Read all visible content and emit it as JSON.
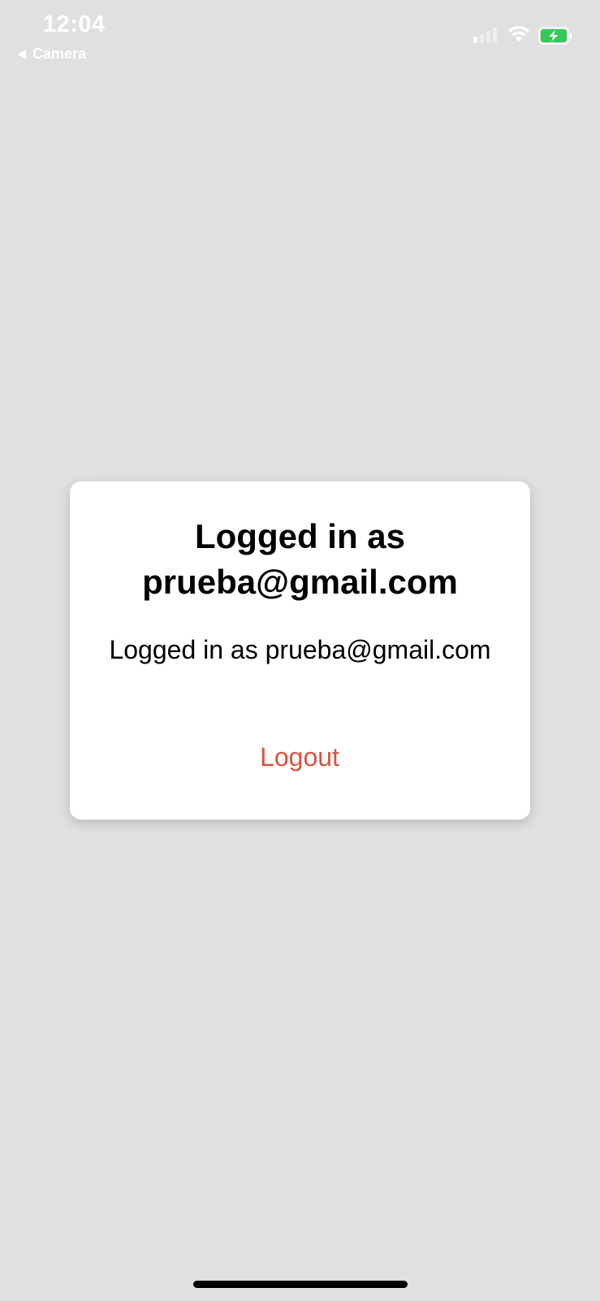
{
  "status_bar": {
    "time": "12:04",
    "back_app_label": "Camera",
    "signal_icon": "cellular-signal-icon",
    "wifi_icon": "wifi-icon",
    "battery_icon": "battery-charging-icon",
    "battery_color": "#34c759"
  },
  "dialog": {
    "title": "Logged in as prueba@gmail.com",
    "message": "Logged in as prueba@gmail.com",
    "logout_label": "Logout",
    "logout_color": "#d9533f"
  },
  "colors": {
    "background": "#e0e0e0",
    "card": "#ffffff"
  }
}
